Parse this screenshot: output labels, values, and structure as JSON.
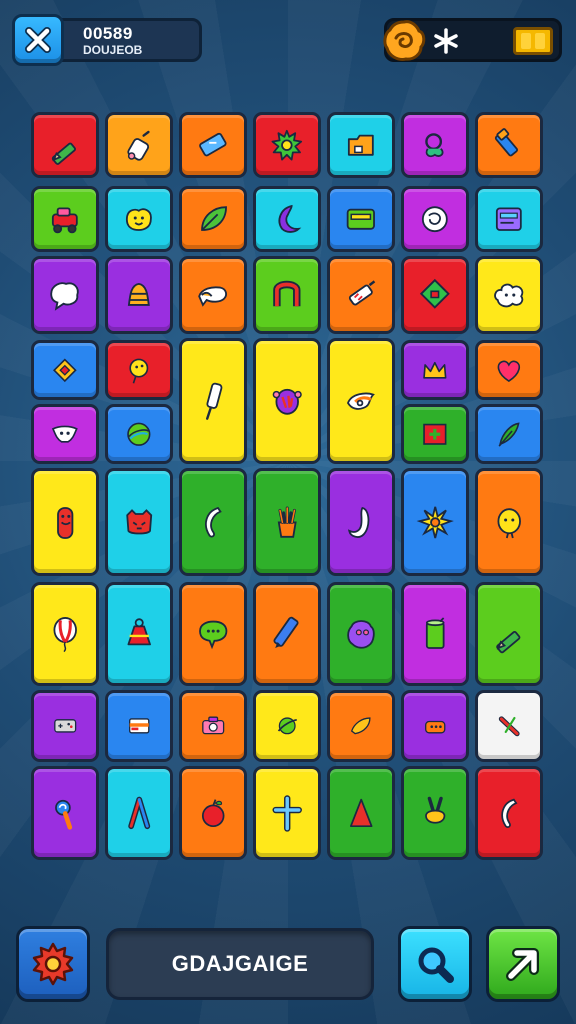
{
  "header": {
    "score_value": "00589",
    "score_sub": "DOUJЕOB"
  },
  "footer": {
    "name_field": "GDAJGAIGE"
  },
  "colors": {
    "red": "#e8202a",
    "orange": "#ff7a12",
    "amber": "#ffa31a",
    "yellow": "#ffe81a",
    "lime": "#5ccd1e",
    "green": "#2fb02a",
    "cyan": "#1fd0e8",
    "blue": "#2a86f0",
    "purple": "#9a2fe0",
    "magenta": "#c12ee0",
    "white": "#f4f4f4"
  },
  "tiles": [
    {
      "id": "r1c1",
      "color": "red",
      "icon": "pencil-icon"
    },
    {
      "id": "r1c2",
      "color": "amber",
      "icon": "glue-bottle-icon"
    },
    {
      "id": "r1c3",
      "color": "orange",
      "icon": "battery-icon"
    },
    {
      "id": "r1c4",
      "color": "red",
      "icon": "sun-gear-icon"
    },
    {
      "id": "r1c5",
      "color": "cyan",
      "icon": "folder-icon"
    },
    {
      "id": "r1c6",
      "color": "magenta",
      "icon": "creature-icon"
    },
    {
      "id": "r1c7",
      "color": "orange",
      "icon": "marker-icon"
    },
    {
      "id": "r2c1",
      "color": "lime",
      "icon": "robot-car-icon"
    },
    {
      "id": "r2c2",
      "color": "cyan",
      "icon": "smiley-face-icon"
    },
    {
      "id": "r2c3",
      "color": "orange",
      "icon": "leaf-icon"
    },
    {
      "id": "r2c4",
      "color": "cyan",
      "icon": "moon-icon"
    },
    {
      "id": "r2c5",
      "color": "blue",
      "icon": "card-icon"
    },
    {
      "id": "r2c6",
      "color": "magenta",
      "icon": "bowl-icon"
    },
    {
      "id": "r2c7",
      "color": "cyan",
      "icon": "tablet-icon"
    },
    {
      "id": "r3c1",
      "color": "purple",
      "icon": "speech-bubble-icon"
    },
    {
      "id": "r3c2",
      "color": "purple",
      "icon": "bell-icon"
    },
    {
      "id": "r3c3",
      "color": "orange",
      "icon": "hand-icon"
    },
    {
      "id": "r3c4",
      "color": "lime",
      "icon": "magnet-icon"
    },
    {
      "id": "r3c5",
      "color": "orange",
      "icon": "syringe-icon"
    },
    {
      "id": "r3c6",
      "color": "red",
      "icon": "diamond-gem-icon"
    },
    {
      "id": "r3c7",
      "color": "yellow",
      "icon": "cloud-face-icon"
    },
    {
      "id": "r4c1",
      "color": "blue",
      "icon": "square-badge-icon"
    },
    {
      "id": "r4c2",
      "color": "red",
      "icon": "lightbulb-icon"
    },
    {
      "id": "r4c3",
      "color": "cyan",
      "icon": "stick-icon"
    },
    {
      "id": "r4c4",
      "color": "yellow",
      "icon": "monster-icon"
    },
    {
      "id": "r4c5",
      "color": "yellow",
      "icon": "bird-icon"
    },
    {
      "id": "r4c6",
      "color": "purple",
      "icon": "crown-icon"
    },
    {
      "id": "r4c7",
      "color": "orange",
      "icon": "heart-icon"
    },
    {
      "id": "r5c1",
      "color": "magenta",
      "icon": "cow-icon"
    },
    {
      "id": "r5c2",
      "color": "blue",
      "icon": "ball-icon"
    },
    {
      "id": "r5c6",
      "color": "green",
      "icon": "medkit-icon"
    },
    {
      "id": "r5c7",
      "color": "blue",
      "icon": "feather-icon"
    },
    {
      "id": "r6c1",
      "color": "yellow",
      "icon": "figure-icon"
    },
    {
      "id": "r6c2",
      "color": "cyan",
      "icon": "cat-face-icon"
    },
    {
      "id": "r6c3",
      "color": "green",
      "icon": "banana-icon"
    },
    {
      "id": "r6c4",
      "color": "green",
      "icon": "plant-pot-icon"
    },
    {
      "id": "r6c5",
      "color": "purple",
      "icon": "hook-icon"
    },
    {
      "id": "r6c6",
      "color": "blue",
      "icon": "flower-icon"
    },
    {
      "id": "r6c7",
      "color": "orange",
      "icon": "egg-face-icon"
    },
    {
      "id": "r7c1",
      "color": "yellow",
      "icon": "balloon-icon"
    },
    {
      "id": "r7c2",
      "color": "cyan",
      "icon": "bell-stand-icon"
    },
    {
      "id": "r7c3",
      "color": "orange",
      "icon": "chat-bubble-icon"
    },
    {
      "id": "r7c4",
      "color": "orange",
      "icon": "crayon-icon"
    },
    {
      "id": "r7c5",
      "color": "green",
      "icon": "blob-monster-icon"
    },
    {
      "id": "r7c6",
      "color": "magenta",
      "icon": "can-icon"
    },
    {
      "id": "r7c7",
      "color": "lime",
      "icon": "pencil-icon"
    },
    {
      "id": "r8c1",
      "color": "purple",
      "icon": "gamepad-icon"
    },
    {
      "id": "r8c2",
      "color": "blue",
      "icon": "id-card-icon"
    },
    {
      "id": "r8c3",
      "color": "orange",
      "icon": "camera-icon"
    },
    {
      "id": "r8c4",
      "color": "yellow",
      "icon": "planet-icon"
    },
    {
      "id": "r8c5",
      "color": "orange",
      "icon": "taco-icon"
    },
    {
      "id": "r8c6",
      "color": "purple",
      "icon": "toaster-icon"
    },
    {
      "id": "r8c7",
      "color": "white",
      "icon": "cross-tools-icon"
    },
    {
      "id": "r9c1",
      "color": "purple",
      "icon": "lollipop-icon"
    },
    {
      "id": "r9c2",
      "color": "cyan",
      "icon": "compass-icon"
    },
    {
      "id": "r9c3",
      "color": "orange",
      "icon": "apple-icon"
    },
    {
      "id": "r9c4",
      "color": "yellow",
      "icon": "cross-icon"
    },
    {
      "id": "r9c5",
      "color": "green",
      "icon": "cone-icon"
    },
    {
      "id": "r9c6",
      "color": "green",
      "icon": "bunny-icon"
    },
    {
      "id": "r9c7",
      "color": "red",
      "icon": "banana-icon"
    }
  ],
  "big_tiles": [
    {
      "id": "stick-big",
      "color": "yellow",
      "icon": "stick-icon"
    },
    {
      "id": "monster-big",
      "color": "yellow",
      "icon": "monster-icon"
    },
    {
      "id": "bird-big",
      "color": "yellow",
      "icon": "bird-icon"
    }
  ]
}
